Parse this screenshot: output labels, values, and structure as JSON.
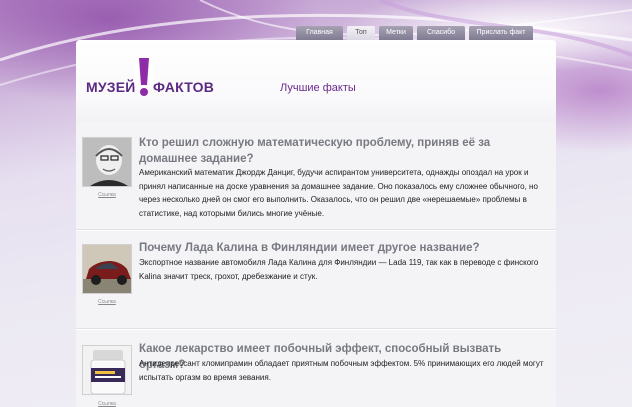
{
  "nav": {
    "items": [
      {
        "label": "Главная"
      },
      {
        "label": "Топ"
      },
      {
        "label": "Метки"
      },
      {
        "label": "Спасибо"
      },
      {
        "label": "Прислать факт"
      }
    ],
    "active": "Топ"
  },
  "logo": {
    "word1": "МУЗЕЙ",
    "word2": "ФАКТОВ",
    "brand_color": "#5a2a83",
    "accent": "#8e2ba6"
  },
  "tagline": "Лучшие факты",
  "facts": [
    {
      "title": "Кто решил сложную математическую проблему, приняв её за домашнее задание?",
      "text": "Американский математик Джордж Данциг, будучи аспирантом университета, однажды опоздал на урок и принял написанные на доске уравнения за домашнее задание. Оно показалось ему сложнее обычного, но через несколько дней он смог его выполнить. Оказалось, что он решил две «нерешаемые» проблемы в статистике, над которыми бились многие учёные.",
      "source_label": "Ссылка",
      "image": "portrait-photo"
    },
    {
      "title": "Почему Лада Калина в Финляндии имеет другое название?",
      "text": "Экспортное название автомобиля Лада Калина для Финляндии — Lada 119, так как в переводе с финского Kalina значит треск, грохот, дребезжание и стук.",
      "source_label": "Ссылка",
      "image": "car-photo"
    },
    {
      "title": "Какое лекарство имеет побочный эффект, способный вызвать оргазм?",
      "text": "Антидепрессант кломипрамин обладает приятным побочным эффектом. 5% принимающих его людей могут испытать оргазм во время зевания.",
      "source_label": "Ссылка",
      "image": "pill-bottle-photo"
    }
  ]
}
